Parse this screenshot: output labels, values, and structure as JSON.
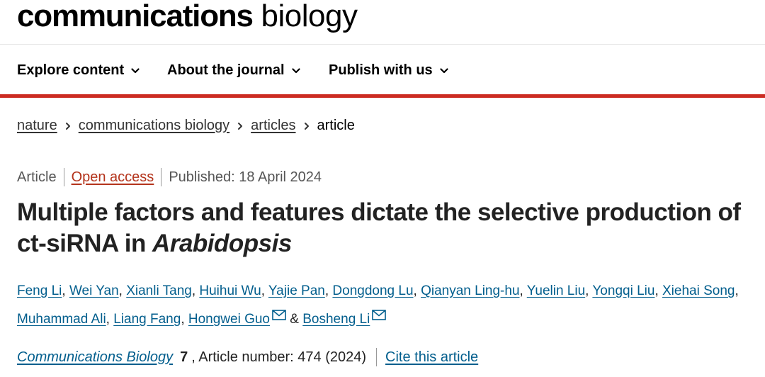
{
  "header": {
    "logo_bold": "communications",
    "logo_light": " biology"
  },
  "nav": {
    "items": [
      {
        "label": "Explore content"
      },
      {
        "label": "About the journal"
      },
      {
        "label": "Publish with us"
      }
    ]
  },
  "breadcrumb": {
    "items": [
      "nature",
      "communications biology",
      "articles"
    ],
    "current": "article"
  },
  "article": {
    "type": "Article",
    "access": "Open access",
    "published": "Published: 18 April 2024",
    "title_start": "Multiple factors and features dictate the selective production of ct-siRNA in ",
    "title_italic": "Arabidopsis",
    "authors": [
      "Feng Li",
      "Wei Yan",
      "Xianli Tang",
      "Huihui Wu",
      "Yajie Pan",
      "Dongdong Lu",
      "Qianyan Ling-hu",
      "Yuelin Liu",
      "Yongqi Liu",
      "Xiehai Song",
      "Muhammad Ali",
      "Liang Fang",
      "Hongwei Guo",
      "Bosheng Li"
    ],
    "author_joiner": "&",
    "journal": "Communications Biology",
    "volume": "7",
    "article_number": ", Article number: 474 (2024)",
    "cite_label": "Cite this article"
  },
  "colors": {
    "accent_red": "#cc2b22",
    "link_blue": "#025e8d",
    "open_access": "#b4341c"
  }
}
